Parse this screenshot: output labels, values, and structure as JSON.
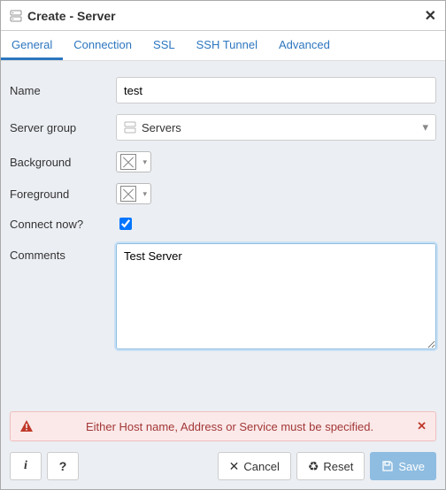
{
  "window": {
    "title": "Create - Server"
  },
  "tabs": [
    {
      "key": "general",
      "label": "General",
      "active": true
    },
    {
      "key": "connection",
      "label": "Connection",
      "active": false
    },
    {
      "key": "ssl",
      "label": "SSL",
      "active": false
    },
    {
      "key": "ssh_tunnel",
      "label": "SSH Tunnel",
      "active": false
    },
    {
      "key": "advanced",
      "label": "Advanced",
      "active": false
    }
  ],
  "form": {
    "name": {
      "label": "Name",
      "value": "test"
    },
    "server_group": {
      "label": "Server group",
      "value": "Servers"
    },
    "background": {
      "label": "Background",
      "value": "none"
    },
    "foreground": {
      "label": "Foreground",
      "value": "none"
    },
    "connect_now": {
      "label": "Connect now?",
      "checked": true
    },
    "comments": {
      "label": "Comments",
      "value": "Test Server"
    }
  },
  "alert": {
    "message": "Either Host name, Address or Service must be specified."
  },
  "footer": {
    "info_label": "i",
    "help_label": "?",
    "cancel_label": "Cancel",
    "reset_label": "Reset",
    "save_label": "Save"
  }
}
